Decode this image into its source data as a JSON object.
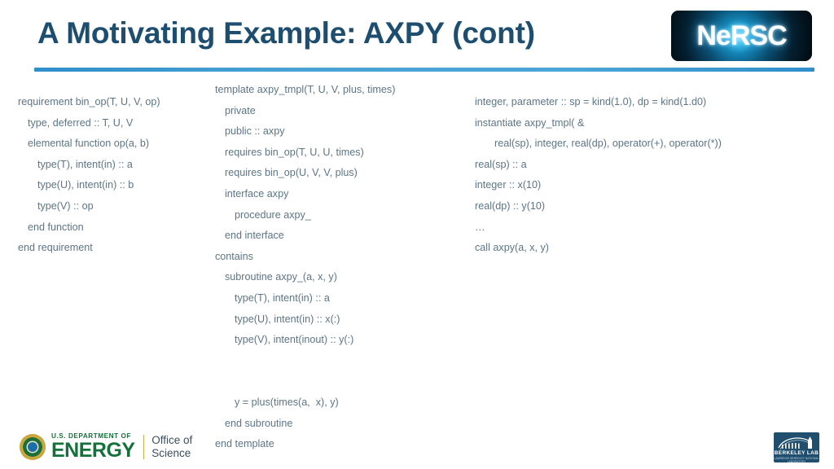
{
  "slide": {
    "title": "A Motivating Example: AXPY (cont)",
    "background_color": "#ffffff",
    "title_color": "#1d4e70",
    "rule_color": "#3f9bd2",
    "code_color": "#5c7585"
  },
  "nersc_logo": {
    "wordmark": "NeRSC",
    "alt": "NERSC logo"
  },
  "code_columns": {
    "left": {
      "name": "requirement-block",
      "lines": [
        {
          "indent": 0,
          "text": "requirement bin_op(T, U, V, op)"
        },
        {
          "indent": 1,
          "text": "type, deferred :: T, U, V"
        },
        {
          "indent": 1,
          "text": "elemental function op(a, b)"
        },
        {
          "indent": 2,
          "text": "type(T), intent(in) :: a"
        },
        {
          "indent": 2,
          "text": "type(U), intent(in) :: b"
        },
        {
          "indent": 2,
          "text": "type(V) :: op"
        },
        {
          "indent": 1,
          "text": "end function"
        },
        {
          "indent": 0,
          "text": "end requirement"
        }
      ]
    },
    "middle": {
      "name": "template-block",
      "lines": [
        {
          "indent": 0,
          "text": "template axpy_tmpl(T, U, V, plus, times)"
        },
        {
          "indent": 1,
          "text": "private"
        },
        {
          "indent": 1,
          "text": "public :: axpy"
        },
        {
          "indent": 1,
          "text": "requires bin_op(T, U, U, times)"
        },
        {
          "indent": 1,
          "text": "requires bin_op(U, V, V, plus)"
        },
        {
          "indent": 1,
          "text": "interface axpy"
        },
        {
          "indent": 2,
          "text": "procedure axpy_"
        },
        {
          "indent": 1,
          "text": "end interface"
        },
        {
          "indent": 0,
          "text": "contains"
        },
        {
          "indent": 1,
          "text": "subroutine axpy_(a, x, y)"
        },
        {
          "indent": 2,
          "text": "type(T), intent(in) :: a"
        },
        {
          "indent": 2,
          "text": "type(U), intent(in) :: x(:)"
        },
        {
          "indent": 2,
          "text": "type(V), intent(inout) :: y(:)"
        },
        {
          "indent": 0,
          "text": ""
        },
        {
          "indent": 0,
          "text": ""
        },
        {
          "indent": 2,
          "text": "y = plus(times(a,  x), y)"
        },
        {
          "indent": 1,
          "text": "end subroutine"
        },
        {
          "indent": 0,
          "text": "end template"
        }
      ]
    },
    "right": {
      "name": "instantiation-block",
      "lines": [
        {
          "indent": 0,
          "text": "integer, parameter :: sp = kind(1.0), dp = kind(1.d0)"
        },
        {
          "indent": 0,
          "text": "instantiate axpy_tmpl( &"
        },
        {
          "indent": 2,
          "text": "real(sp), integer, real(dp), operator(+), operator(*))"
        },
        {
          "indent": 0,
          "text": "real(sp) :: a"
        },
        {
          "indent": 0,
          "text": "integer :: x(10)"
        },
        {
          "indent": 0,
          "text": "real(dp) :: y(10)"
        },
        {
          "indent": 0,
          "text": "…"
        },
        {
          "indent": 0,
          "text": "call axpy(a, x, y)"
        }
      ]
    }
  },
  "doe_logo": {
    "department_line": "U.S. DEPARTMENT OF",
    "energy_line": "ENERGY",
    "office_line_1": "Office of",
    "office_line_2": "Science"
  },
  "berkeley_logo": {
    "name": "BERKELEY LAB",
    "subtitle": "LAWRENCE BERKELEY NATIONAL LABORATORY"
  }
}
